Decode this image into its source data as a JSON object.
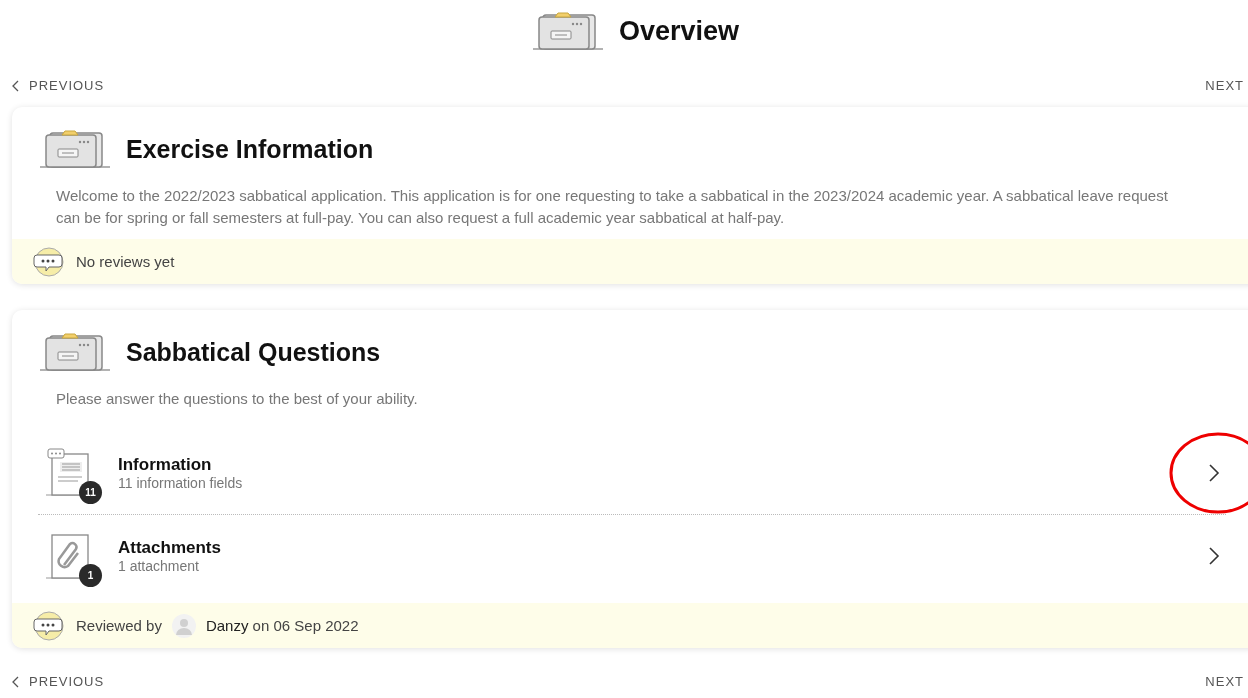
{
  "header": {
    "title": "Overview"
  },
  "nav_top": {
    "previous": "PREVIOUS",
    "next": "NEXT"
  },
  "sections": [
    {
      "title": "Exercise Information",
      "description": "Welcome to the 2022/2023 sabbatical application. This application is for one requesting to take a sabbatical in the 2023/2024 academic year. A sabbatical leave request can be for spring or fall semesters at full-pay. You can also request a full academic year sabbatical at half-pay.",
      "review": {
        "kind": "none",
        "text": "No reviews yet"
      }
    },
    {
      "title": "Sabbatical Questions",
      "description": "Please answer the questions to the best of your ability.",
      "items": [
        {
          "kind": "form",
          "title": "Information",
          "subtitle": "11 information fields",
          "count": "11",
          "annotated": true
        },
        {
          "kind": "attachment",
          "title": "Attachments",
          "subtitle": "1 attachment",
          "count": "1",
          "annotated": false
        }
      ],
      "review": {
        "kind": "reviewed",
        "prefix": "Reviewed by",
        "reviewer": "Danzy",
        "suffix": "on 06 Sep 2022"
      }
    }
  ],
  "nav_bottom": {
    "previous": "PREVIOUS",
    "next": "NEXT"
  }
}
